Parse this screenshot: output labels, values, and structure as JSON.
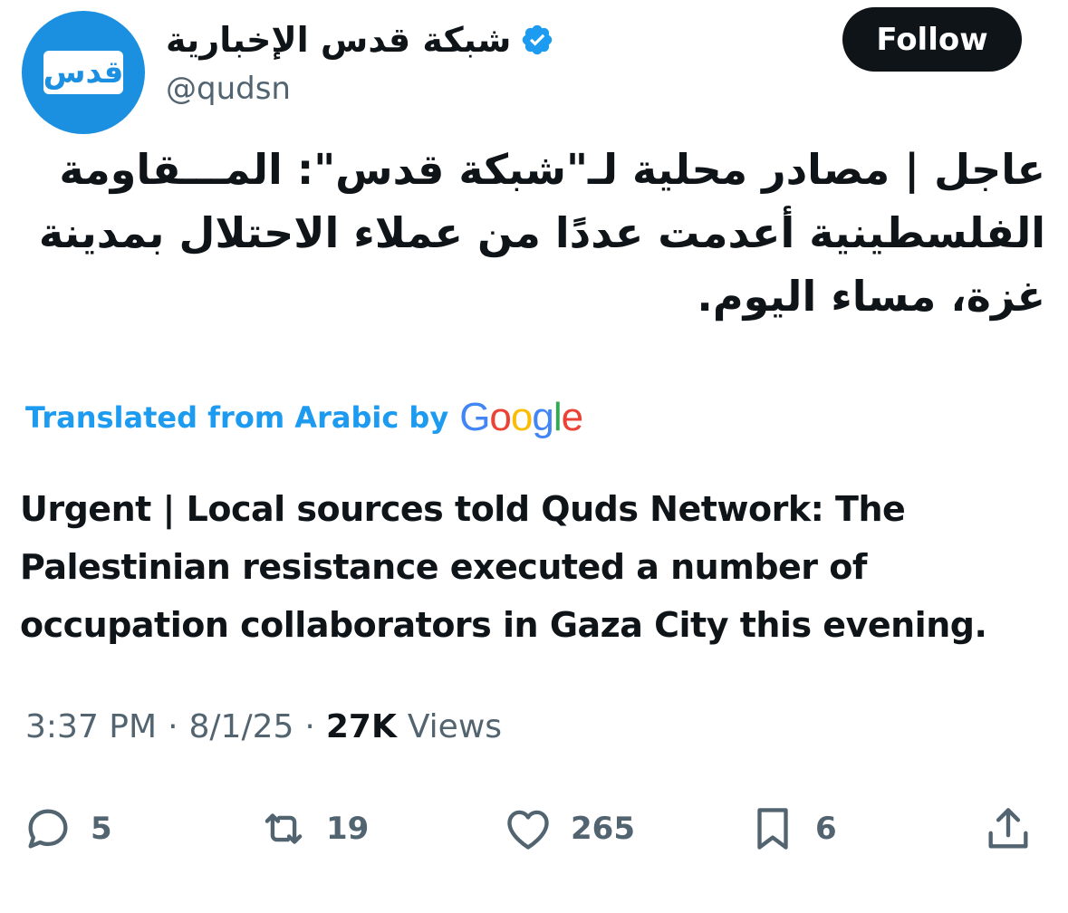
{
  "account": {
    "avatar_text": "قدس",
    "display_name": "شبكة قدس الإخبارية",
    "handle": "@qudsn",
    "verified_icon": "verified-badge-icon",
    "follow_label": "Follow"
  },
  "tweet": {
    "arabic_text": "عاجل | مصادر محلية لـ\"شبكة قدس\": المـــقاومة الفلسطينية أعدمت عددًا من عملاء الاحتلال بمدينة غزة، مساء اليوم.",
    "translated_label": "Translated from Arabic by",
    "google_logo": [
      "G",
      "o",
      "o",
      "g",
      "l",
      "e"
    ],
    "english_text": "Urgent | Local sources told Quds Network: The Palestinian resistance executed a number of occupation collaborators in Gaza City this evening."
  },
  "meta": {
    "time": "3:37 PM",
    "separator": "·",
    "date": "8/1/25",
    "views_count": "27K",
    "views_label": "Views"
  },
  "actions": {
    "reply_count": "5",
    "retweet_count": "19",
    "like_count": "265",
    "bookmark_count": "6",
    "icons": [
      "reply-icon",
      "retweet-icon",
      "like-icon",
      "bookmark-icon",
      "share-icon"
    ]
  },
  "colors": {
    "link_blue": "#1d9bf0",
    "avatar_blue": "#1b8fe0",
    "text_primary": "#0f1419",
    "text_secondary": "#536471"
  }
}
